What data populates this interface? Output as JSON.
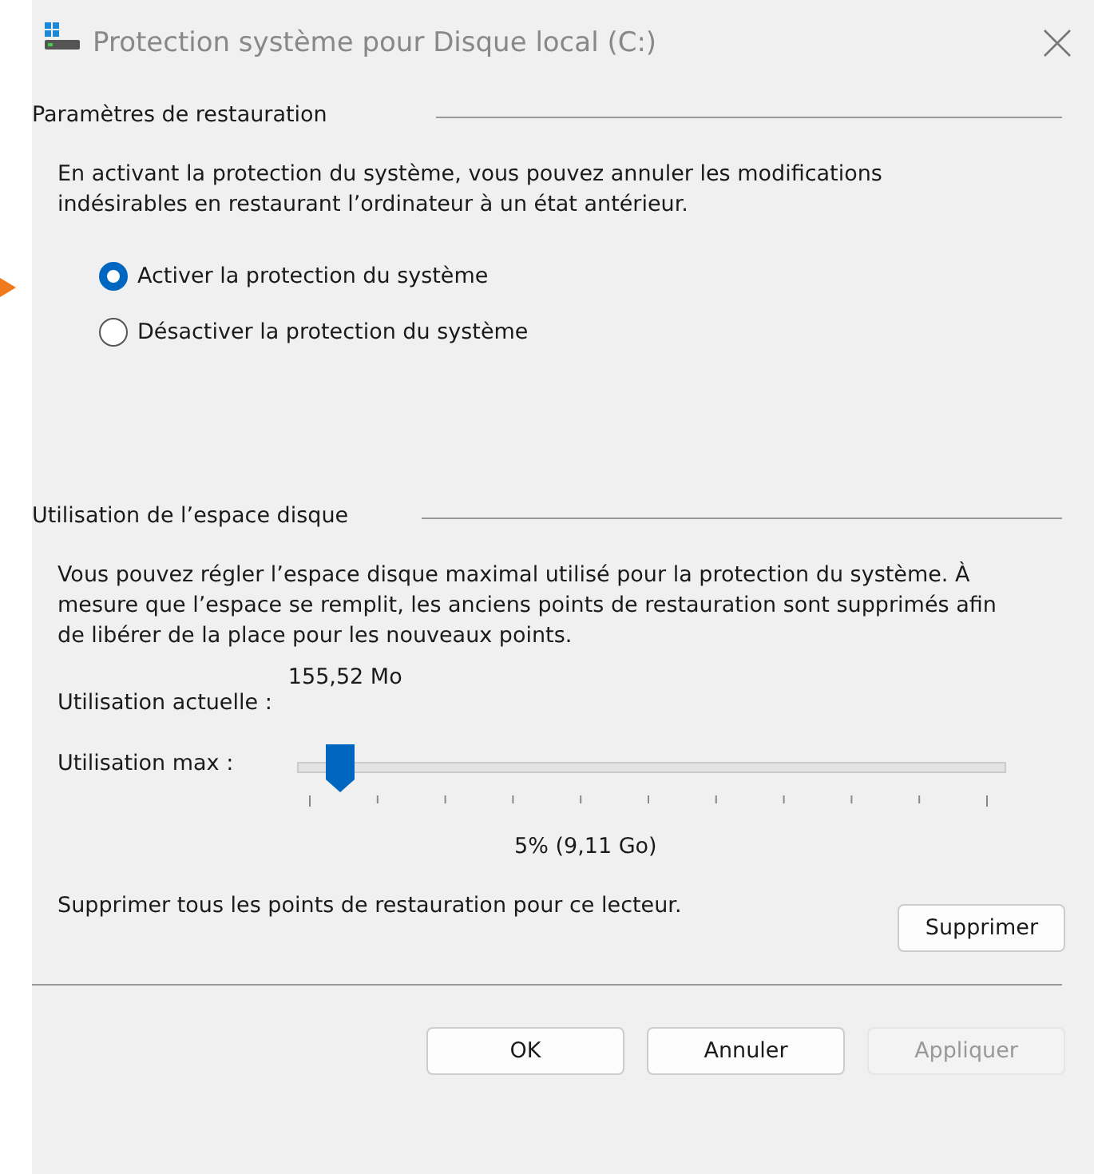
{
  "window": {
    "title": "Protection système pour Disque local (C:)"
  },
  "restore_settings": {
    "heading": "Paramètres de restauration",
    "description": "En activant la protection du système, vous pouvez annuler les modifications indésirables en restaurant l’ordinateur à un état antérieur.",
    "options": [
      {
        "label": "Activer la protection du système",
        "selected": true
      },
      {
        "label": "Désactiver la protection du système",
        "selected": false
      }
    ]
  },
  "disk_usage": {
    "heading": "Utilisation de l’espace disque",
    "description": "Vous pouvez régler l’espace disque maximal utilisé pour la protection du système. À mesure que l’espace se remplit, les anciens points de restauration sont supprimés afin de libérer de la place pour les nouveaux points.",
    "current_label": "Utilisation actuelle :",
    "current_value": "155,52 Mo",
    "max_label": "Utilisation max :",
    "max_slider": {
      "level": 0.06
    },
    "max_value": "5% (9,11 Go)",
    "delete_text": "Supprimer tous les points de restauration pour ce lecteur.",
    "delete_button": "Supprimer"
  },
  "buttons": [
    {
      "label": "OK",
      "disabled": false
    },
    {
      "label": "Annuler",
      "disabled": false
    },
    {
      "label": "Appliquer",
      "disabled": true
    }
  ]
}
